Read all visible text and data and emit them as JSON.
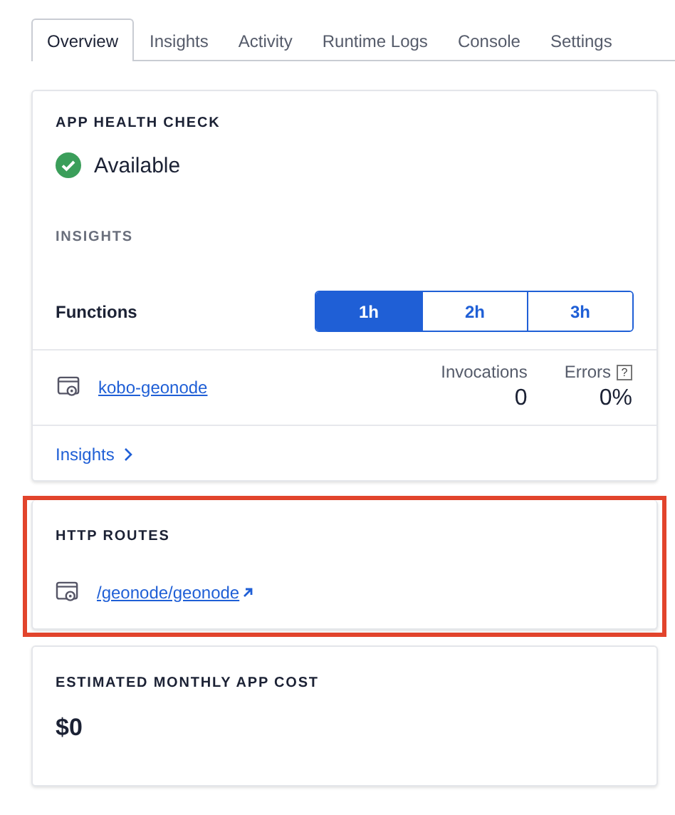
{
  "tabs": [
    {
      "label": "Overview",
      "selected": true
    },
    {
      "label": "Insights",
      "selected": false
    },
    {
      "label": "Activity",
      "selected": false
    },
    {
      "label": "Runtime Logs",
      "selected": false
    },
    {
      "label": "Console",
      "selected": false
    },
    {
      "label": "Settings",
      "selected": false
    }
  ],
  "health": {
    "heading": "APP HEALTH CHECK",
    "status": "Available",
    "ok": true
  },
  "insights": {
    "heading": "INSIGHTS",
    "label": "Functions",
    "ranges": [
      {
        "label": "1h",
        "selected": true
      },
      {
        "label": "2h",
        "selected": false
      },
      {
        "label": "3h",
        "selected": false
      }
    ],
    "columns": [
      {
        "label": "Invocations"
      },
      {
        "label": "Errors",
        "help": "?"
      }
    ],
    "functions": [
      {
        "name": "kobo-geonode",
        "values": [
          "0",
          "0%"
        ]
      }
    ],
    "link": "Insights"
  },
  "routes": {
    "heading": "HTTP ROUTES",
    "highlighted": true,
    "items": [
      {
        "path": "/geonode/geonode"
      }
    ]
  },
  "cost": {
    "heading": "ESTIMATED MONTHLY APP COST",
    "value": "$0"
  }
}
